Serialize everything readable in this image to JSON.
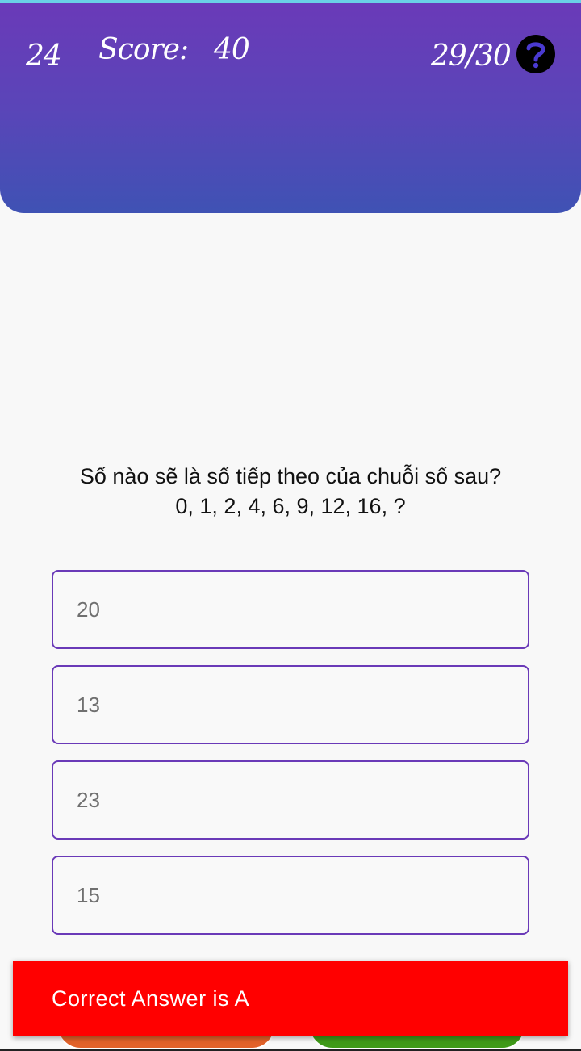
{
  "header": {
    "timer": "24",
    "score_label": "Score:",
    "score_value": "40",
    "progress": "29/30",
    "help_icon": "question-mark-icon",
    "gradient_top": "#6a3ab8",
    "gradient_bottom": "#3f52b4"
  },
  "question": {
    "line1": "Số nào sẽ là số tiếp theo của chuỗi số sau?",
    "line2": "0, 1, 2, 4, 6, 9, 12, 16, ?"
  },
  "options": [
    {
      "label": "20"
    },
    {
      "label": "13"
    },
    {
      "label": "23"
    },
    {
      "label": "15"
    }
  ],
  "snackbar": {
    "message": "Correct Answer is A",
    "color": "#ff0000"
  },
  "buttons": {
    "left_color": "#e2622a",
    "right_color": "#3f9a18"
  }
}
